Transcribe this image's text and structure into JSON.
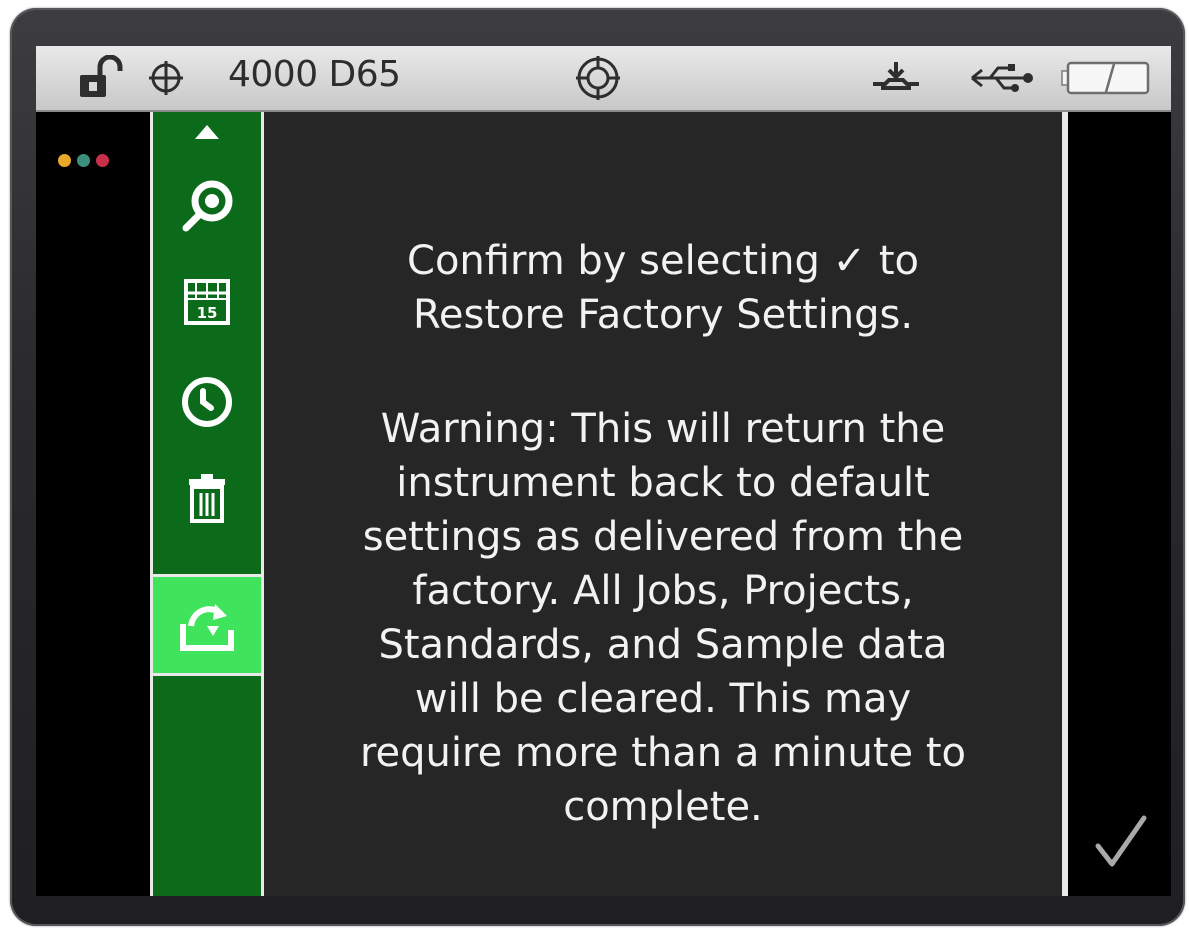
{
  "status_bar": {
    "lock_icon": "unlocked-padlock-icon",
    "target_icon": "crosshair-icon",
    "title": "4000 D65",
    "center_icon": "aperture-target-icon",
    "dock_icon": "dock-icon",
    "usb_icon": "usb-icon",
    "battery_icon": "battery-icon"
  },
  "indicator_dots": [
    "#e8a82c",
    "#3a8f7d",
    "#c8304a"
  ],
  "sidebar": {
    "items": [
      {
        "icon": "scroll-up-arrow-icon"
      },
      {
        "icon": "zoom-select-icon"
      },
      {
        "icon": "calendar-icon",
        "label": "15"
      },
      {
        "icon": "clock-icon"
      },
      {
        "icon": "trash-icon"
      },
      {
        "icon": "restore-factory-icon",
        "active": true
      }
    ]
  },
  "dialog": {
    "confirm_before": "Confirm by selecting",
    "confirm_check": "✓",
    "confirm_after": "to\nRestore Factory Settings.",
    "warning": "Warning: This will return the\ninstrument back to default\nsettings as delivered from the\nfactory.  All Jobs, Projects,\nStandards, and Sample data\nwill be cleared.  This may\nrequire more than a minute to\ncomplete."
  },
  "confirm_button": {
    "icon": "checkmark-icon"
  },
  "colors": {
    "sidebar_green": "#0b6b1b",
    "active_green": "#3fe35c",
    "panel_bg": "#262626",
    "status_bar_bg": "#d9d9d9"
  }
}
